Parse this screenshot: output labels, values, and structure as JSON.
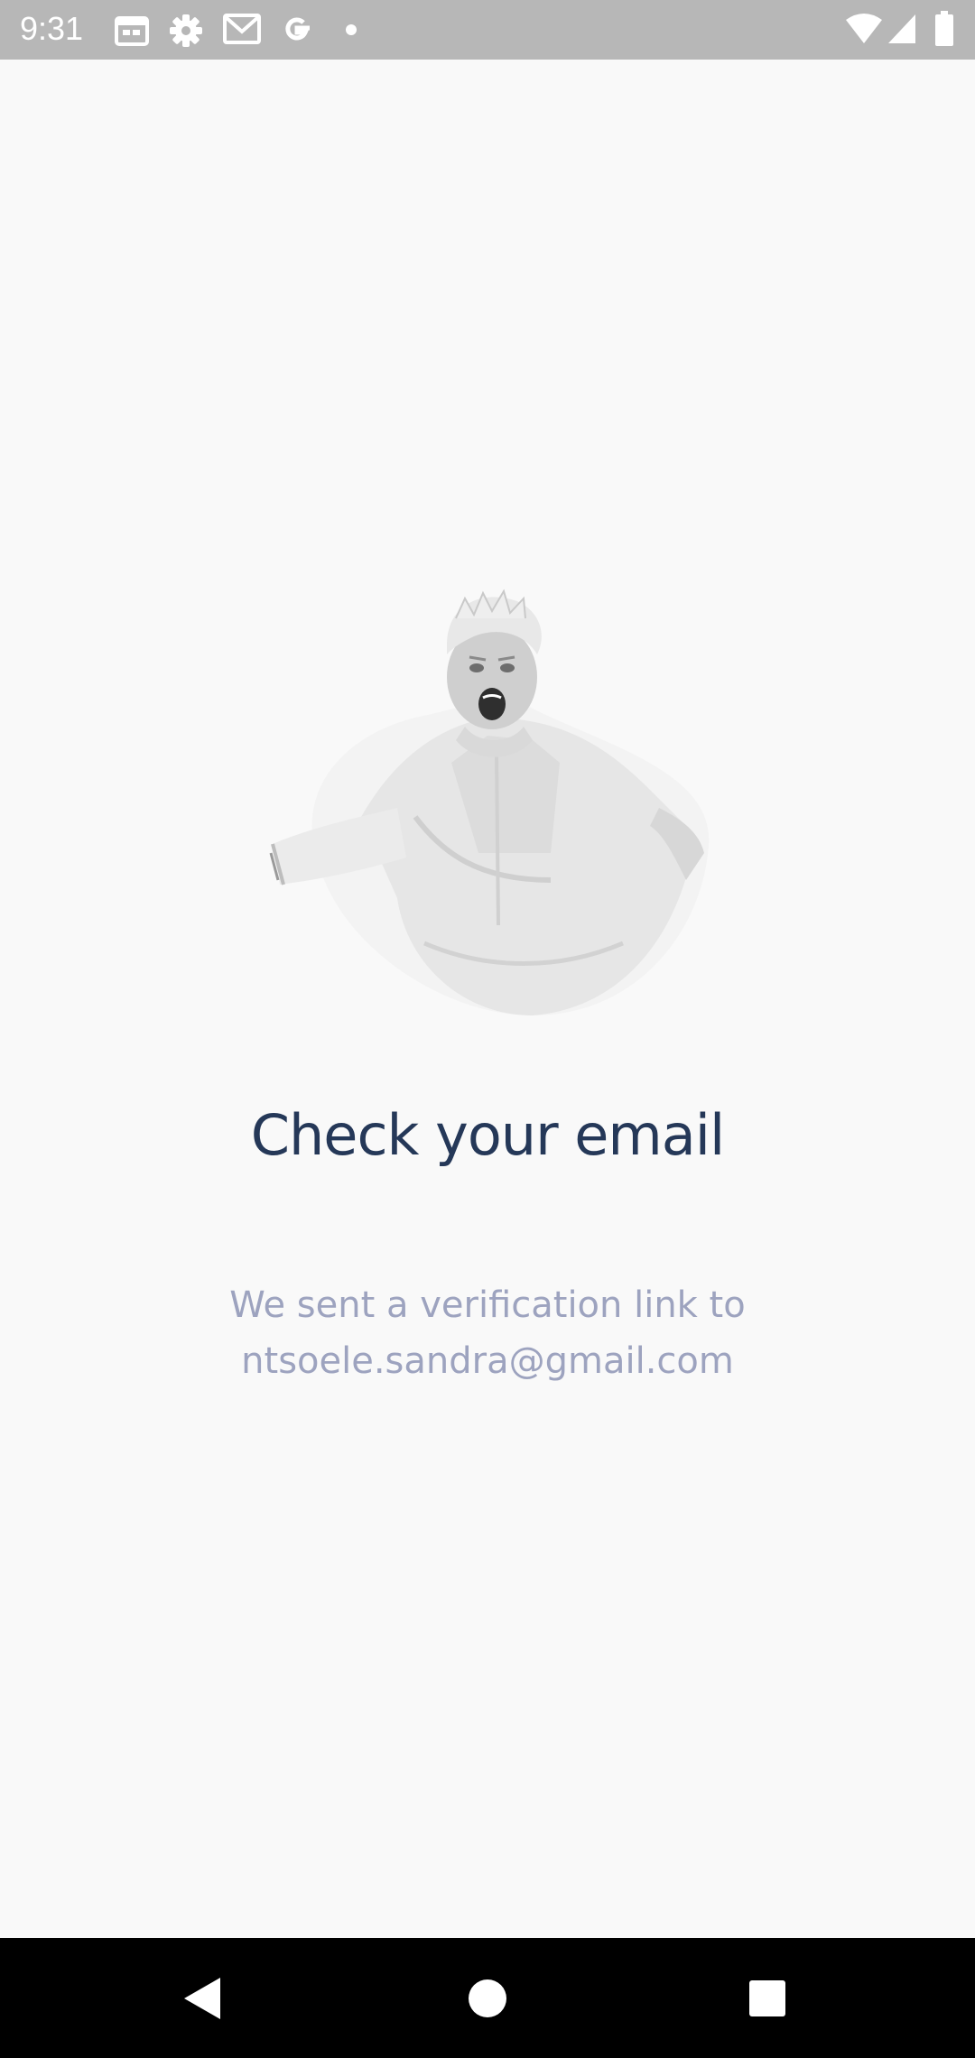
{
  "status_bar": {
    "time": "9:31",
    "left_icons": [
      "calendar-icon",
      "settings-icon",
      "gmail-icon",
      "google-icon",
      "notification-dot-icon"
    ],
    "right_icons": [
      "wifi-icon",
      "cell-signal-icon",
      "battery-icon"
    ]
  },
  "main": {
    "illustration": "chef-shouting-illustration",
    "title": "Check your email",
    "message_line1": "We sent a verification link to",
    "message_line2": "ntsoele.sandra@gmail.com"
  },
  "nav_bar": {
    "buttons": [
      "back-icon",
      "home-icon",
      "recents-icon"
    ]
  },
  "colors": {
    "title": "#253858",
    "subtitle": "#9da3bf",
    "background": "#f9f9f9",
    "status_bar": "#b7b7b7",
    "nav_bar": "#000000"
  }
}
